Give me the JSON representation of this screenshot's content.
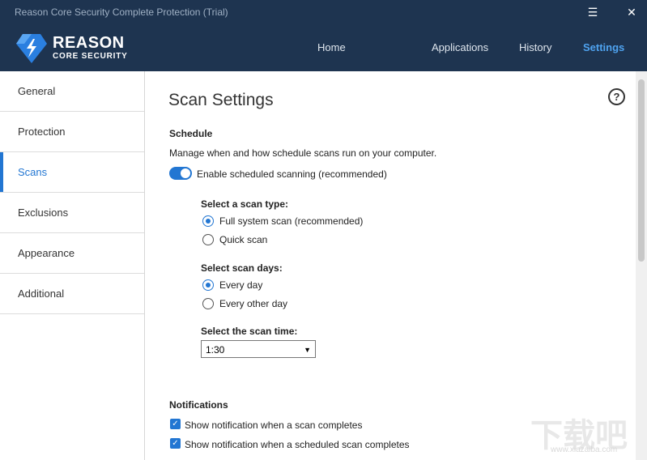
{
  "window": {
    "title": "Reason Core Security Complete Protection (Trial)",
    "menu_icon": "menu-icon",
    "close_icon": "close-icon"
  },
  "header": {
    "brand_line1": "REASON",
    "brand_line2": "CORE SECURITY",
    "nav": [
      {
        "label": "Home",
        "active": false
      },
      {
        "label": "Applications",
        "active": false
      },
      {
        "label": "History",
        "active": false
      },
      {
        "label": "Settings",
        "active": true
      }
    ]
  },
  "sidebar": {
    "items": [
      {
        "label": "General",
        "active": false
      },
      {
        "label": "Protection",
        "active": false
      },
      {
        "label": "Scans",
        "active": true
      },
      {
        "label": "Exclusions",
        "active": false
      },
      {
        "label": "Appearance",
        "active": false
      },
      {
        "label": "Additional",
        "active": false
      }
    ]
  },
  "main": {
    "title": "Scan Settings",
    "help_icon": "help-icon",
    "schedule": {
      "heading": "Schedule",
      "description": "Manage when and how schedule scans run on your computer.",
      "toggle_label": "Enable scheduled scanning (recommended)",
      "toggle_on": true,
      "scan_type_heading": "Select a scan type:",
      "scan_types": [
        {
          "label": "Full system scan (recommended)",
          "selected": true
        },
        {
          "label": "Quick scan",
          "selected": false
        }
      ],
      "scan_days_heading": "Select scan days:",
      "scan_days": [
        {
          "label": "Every day",
          "selected": true
        },
        {
          "label": "Every other day",
          "selected": false
        }
      ],
      "scan_time_heading": "Select the scan time:",
      "scan_time_value": "1:30"
    },
    "notifications": {
      "heading": "Notifications",
      "options": [
        {
          "label": "Show notification when a scan completes",
          "checked": true
        },
        {
          "label": "Show notification when a scheduled scan completes",
          "checked": true
        }
      ]
    }
  },
  "watermark": {
    "text": "下载吧",
    "url": "www.xiazaiba.com"
  },
  "colors": {
    "header_bg": "#1e3450",
    "accent": "#2276d2",
    "nav_active": "#4fa3f0"
  }
}
